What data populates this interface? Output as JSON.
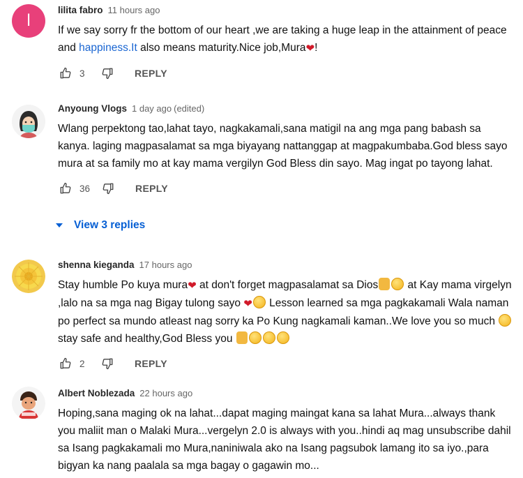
{
  "comments": [
    {
      "author": "lilita fabro",
      "time": "11 hours ago",
      "edited": "",
      "avatar_letter": "l",
      "text_a": "If we say sorry fr the bottom of our heart ,we are taking a huge leap in the attainment of peace and ",
      "link": "happiness.It",
      "text_b": " also means maturity.Nice job,Mura",
      "text_c": "!",
      "likes": "3",
      "reply_label": "REPLY"
    },
    {
      "author": "Anyoung Vlogs",
      "time": "1 day ago",
      "edited": "(edited)",
      "text": "Wlang perpektong tao,lahat tayo, nagkakamali,sana matigil na ang mga pang babash sa kanya. laging magpasalamat sa mga biyayang nattanggap at magpakumbaba.God bless sayo mura at sa family mo at kay mama vergilyn God Bless din sayo.  Mag ingat po tayong lahat.",
      "likes": "36",
      "reply_label": "REPLY",
      "view_replies": "View 3 replies"
    },
    {
      "author": "shenna kieganda",
      "time": "17 hours ago",
      "edited": "",
      "t1": "Stay humble Po kuya mura",
      "t2": " at don't forget magpasalamat sa Dios",
      "t3": " at Kay mama virgelyn ,lalo na sa mga nag Bigay tulong sayo ",
      "t4": " Lesson learned sa mga pagkakamali Wala naman po perfect sa mundo atleast nag sorry ka Po Kung nagkamali kaman..We love you so much ",
      "t5": " stay safe and healthy,God Bless you ",
      "likes": "2",
      "reply_label": "REPLY"
    },
    {
      "author": "Albert Noblezada",
      "time": "22 hours ago",
      "edited": "",
      "text": "Hoping,sana maging ok na lahat...dapat maging maingat kana sa lahat Mura...always thank you maliit man o Malaki Mura...vergelyn 2.0 is always with you..hindi aq mag unsubscribe dahil sa Isang pagkakamali mo Mura,naniniwala ako na Isang pagsubok lamang ito sa iyo.,para bigyan ka nang  paalala sa mga bagay o gagawin mo..."
    }
  ],
  "colors": {
    "link": "#065fd4",
    "avatar_pink": "#e8407a",
    "heart": "#d11a2a"
  }
}
